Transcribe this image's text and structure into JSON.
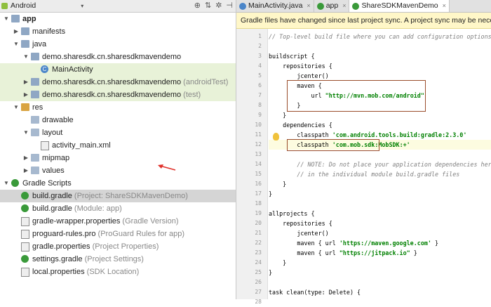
{
  "project_panel": {
    "view_mode": "Android",
    "toolbar_icons": [
      "target-icon",
      "settings-icon",
      "gear-icon",
      "hide-icon"
    ]
  },
  "tree": [
    {
      "indent": 0,
      "arrow": "down",
      "icon": "folder-app",
      "label": "app",
      "hint": "",
      "bold": true,
      "state": ""
    },
    {
      "indent": 1,
      "arrow": "right",
      "icon": "folder",
      "label": "manifests",
      "hint": "",
      "state": ""
    },
    {
      "indent": 1,
      "arrow": "down",
      "icon": "folder",
      "label": "java",
      "hint": "",
      "state": ""
    },
    {
      "indent": 2,
      "arrow": "down",
      "icon": "folder",
      "label": "demo.sharesdk.cn.sharesdkmavendemo",
      "hint": "",
      "state": ""
    },
    {
      "indent": 3,
      "arrow": "",
      "icon": "class",
      "label": "MainActivity",
      "hint": "",
      "state": "hl"
    },
    {
      "indent": 2,
      "arrow": "right",
      "icon": "folder",
      "label": "demo.sharesdk.cn.sharesdkmavendemo",
      "hint": "(androidTest)",
      "state": "hl"
    },
    {
      "indent": 2,
      "arrow": "right",
      "icon": "folder",
      "label": "demo.sharesdk.cn.sharesdkmavendemo",
      "hint": "(test)",
      "state": "hl"
    },
    {
      "indent": 1,
      "arrow": "down",
      "icon": "folder-orange",
      "label": "res",
      "hint": "",
      "state": ""
    },
    {
      "indent": 2,
      "arrow": "",
      "icon": "folder-light",
      "label": "drawable",
      "hint": "",
      "state": ""
    },
    {
      "indent": 2,
      "arrow": "down",
      "icon": "folder-light",
      "label": "layout",
      "hint": "",
      "state": ""
    },
    {
      "indent": 3,
      "arrow": "",
      "icon": "file",
      "label": "activity_main.xml",
      "hint": "",
      "state": ""
    },
    {
      "indent": 2,
      "arrow": "right",
      "icon": "folder-light",
      "label": "mipmap",
      "hint": "",
      "state": ""
    },
    {
      "indent": 2,
      "arrow": "right",
      "icon": "folder-light",
      "label": "values",
      "hint": "",
      "state": ""
    },
    {
      "indent": 0,
      "arrow": "down",
      "icon": "gradle",
      "label": "Gradle Scripts",
      "hint": "",
      "state": ""
    },
    {
      "indent": 1,
      "arrow": "",
      "icon": "gradle",
      "label": "build.gradle",
      "hint": "(Project: ShareSDKMavenDemo)",
      "state": "sel"
    },
    {
      "indent": 1,
      "arrow": "",
      "icon": "gradle",
      "label": "build.gradle",
      "hint": "(Module: app)",
      "state": ""
    },
    {
      "indent": 1,
      "arrow": "",
      "icon": "file",
      "label": "gradle-wrapper.properties",
      "hint": "(Gradle Version)",
      "state": ""
    },
    {
      "indent": 1,
      "arrow": "",
      "icon": "file",
      "label": "proguard-rules.pro",
      "hint": "(ProGuard Rules for app)",
      "state": ""
    },
    {
      "indent": 1,
      "arrow": "",
      "icon": "file",
      "label": "gradle.properties",
      "hint": "(Project Properties)",
      "state": ""
    },
    {
      "indent": 1,
      "arrow": "",
      "icon": "gradle",
      "label": "settings.gradle",
      "hint": "(Project Settings)",
      "state": ""
    },
    {
      "indent": 1,
      "arrow": "",
      "icon": "file",
      "label": "local.properties",
      "hint": "(SDK Location)",
      "state": ""
    }
  ],
  "editor": {
    "tabs": [
      {
        "label": "MainActivity.java",
        "icon": "class",
        "active": false
      },
      {
        "label": "app",
        "icon": "gradle",
        "active": false
      },
      {
        "label": "ShareSDKMavenDemo",
        "icon": "gradle",
        "active": true
      }
    ],
    "banner": "Gradle files have changed since last project sync. A project sync may be necessary fo",
    "lines": [
      {
        "n": "1",
        "text": "// Top-level build file where you can add configuration options common to",
        "cls": "cmt"
      },
      {
        "n": "2",
        "text": ""
      },
      {
        "n": "3",
        "text": "buildscript {"
      },
      {
        "n": "4",
        "text": "    repositories {"
      },
      {
        "n": "5",
        "text": "        jcenter()"
      },
      {
        "n": "6",
        "text": "        maven {"
      },
      {
        "n": "7",
        "pre": "            url ",
        "str": "\"http://mvn.mob.com/android\""
      },
      {
        "n": "8",
        "text": "        }"
      },
      {
        "n": "9",
        "text": "    }"
      },
      {
        "n": "10",
        "text": "    dependencies {"
      },
      {
        "n": "11",
        "pre": "        classpath ",
        "str": "'com.android.tools.build:gradle:2.3.0'"
      },
      {
        "n": "12",
        "pre": "        classpath ",
        "str": "'com.mob.sdk:MobSDK:+'",
        "cur": true
      },
      {
        "n": "13",
        "text": ""
      },
      {
        "n": "14",
        "text": "        // NOTE: Do not place your application dependencies here; they be",
        "cls": "cmt"
      },
      {
        "n": "15",
        "text": "        // in the individual module build.gradle files",
        "cls": "cmt"
      },
      {
        "n": "16",
        "text": "    }"
      },
      {
        "n": "17",
        "text": "}"
      },
      {
        "n": "18",
        "text": ""
      },
      {
        "n": "19",
        "text": "allprojects {"
      },
      {
        "n": "20",
        "text": "    repositories {"
      },
      {
        "n": "21",
        "text": "        jcenter()"
      },
      {
        "n": "22",
        "pre": "        maven { url ",
        "str": "'https://maven.google.com'",
        "post": " }"
      },
      {
        "n": "23",
        "pre": "        maven { url ",
        "str": "\"https://jitpack.io\"",
        "post": " }"
      },
      {
        "n": "24",
        "text": "    }"
      },
      {
        "n": "25",
        "text": "}"
      },
      {
        "n": "26",
        "text": ""
      },
      {
        "n": "27",
        "text": "task clean(type: Delete) {"
      },
      {
        "n": "28",
        "text": "    delete rootProject.buildDir"
      }
    ]
  }
}
